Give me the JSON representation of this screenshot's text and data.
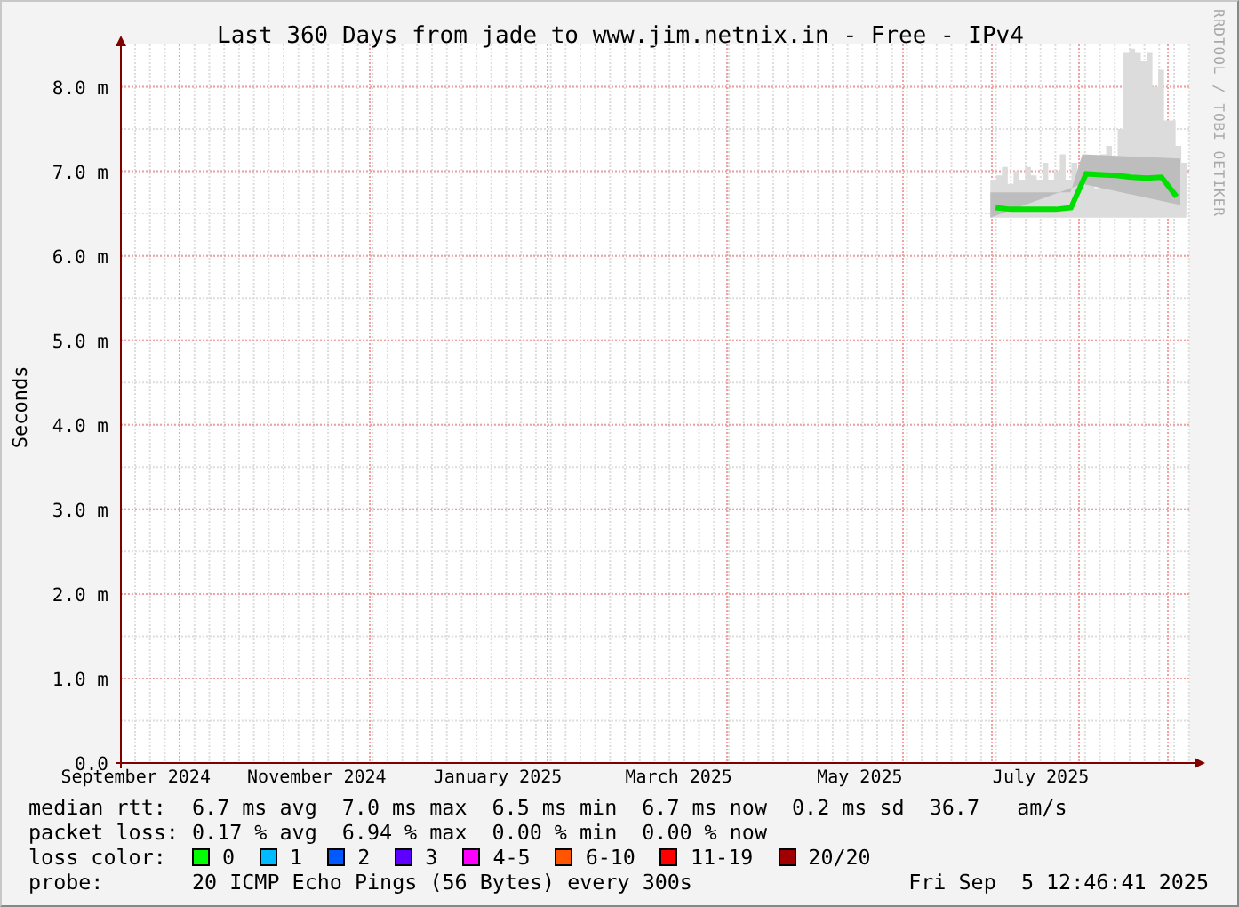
{
  "graph": {
    "title": "Last 360 Days from jade to www.jim.netnix.in - Free - IPv4",
    "credit": "RRDTOOL / TOBI OETIKER",
    "chart_data": {
      "type": "line",
      "ylabel": "Seconds",
      "grid": true,
      "ylim": [
        0,
        8.5
      ],
      "categories": [
        "September 2024",
        null,
        null,
        null,
        null,
        null,
        null,
        null,
        null,
        null,
        null,
        null,
        "November 2024",
        null,
        null,
        null,
        null,
        null,
        null,
        null,
        null,
        null,
        null,
        null,
        "January 2025",
        null,
        null,
        null,
        null,
        null,
        null,
        null,
        null,
        null,
        null,
        null,
        "March 2025",
        null,
        null,
        null,
        null,
        null,
        null,
        null,
        null,
        null,
        null,
        null,
        "May 2025",
        null,
        null,
        null,
        null,
        null,
        null,
        null,
        null,
        null,
        null,
        null,
        "July 2025",
        null,
        null,
        null,
        null,
        null,
        null,
        null,
        null,
        null
      ],
      "yticks": [
        {
          "value": 0,
          "label": "0.0"
        },
        {
          "value": 1,
          "label": "1.0 m"
        },
        {
          "value": 2,
          "label": "2.0 m"
        },
        {
          "value": 3,
          "label": "3.0 m"
        },
        {
          "value": 4,
          "label": "4.0 m"
        },
        {
          "value": 5,
          "label": "5.0 m"
        },
        {
          "value": 6,
          "label": "6.0 m"
        },
        {
          "value": 7,
          "label": "7.0 m"
        },
        {
          "value": 8,
          "label": "8.0 m"
        }
      ],
      "series": [
        {
          "color": "#00e000",
          "values": [
            null,
            null,
            null,
            null,
            null,
            null,
            null,
            null,
            null,
            null,
            null,
            null,
            null,
            null,
            null,
            null,
            null,
            null,
            null,
            null,
            null,
            null,
            null,
            null,
            null,
            null,
            null,
            null,
            null,
            null,
            null,
            null,
            null,
            null,
            null,
            null,
            null,
            null,
            null,
            null,
            null,
            null,
            null,
            null,
            null,
            null,
            null,
            null,
            null,
            null,
            null,
            null,
            null,
            null,
            null,
            null,
            null,
            6.57,
            6.55,
            6.55,
            6.55,
            6.55,
            6.57,
            6.97,
            6.96,
            6.95,
            6.93,
            6.92,
            6.93,
            6.7
          ]
        }
      ]
    }
  },
  "legend": [
    {
      "kind": "stats",
      "label": "median rtt:",
      "values": [
        "6.7 ms avg",
        "7.0 ms max",
        "6.5 ms min",
        "6.7 ms now",
        "0.2 ms sd",
        "36.7   am/s"
      ]
    },
    {
      "kind": "stats",
      "label": "packet loss:",
      "values": [
        "0.17 % avg",
        "6.94 % max",
        "0.00 % min",
        "0.00 % now"
      ]
    },
    {
      "kind": "colors",
      "label": "loss color:",
      "items": [
        {
          "label": "0",
          "color": "#00ff00"
        },
        {
          "label": "1",
          "color": "#00bbff"
        },
        {
          "label": "2",
          "color": "#0059ff"
        },
        {
          "label": "3",
          "color": "#5e00ff"
        },
        {
          "label": "4-5",
          "color": "#ff00ff"
        },
        {
          "label": "6-10",
          "color": "#ff5500"
        },
        {
          "label": "11-19",
          "color": "#ff0000"
        },
        {
          "label": "20/20",
          "color": "#a10000"
        }
      ]
    },
    {
      "kind": "probe",
      "label": "probe:",
      "value": "20 ICMP Echo Pings (56 Bytes) every 300s",
      "timestamp": "Fri Sep  5 12:46:41 2025"
    }
  ]
}
